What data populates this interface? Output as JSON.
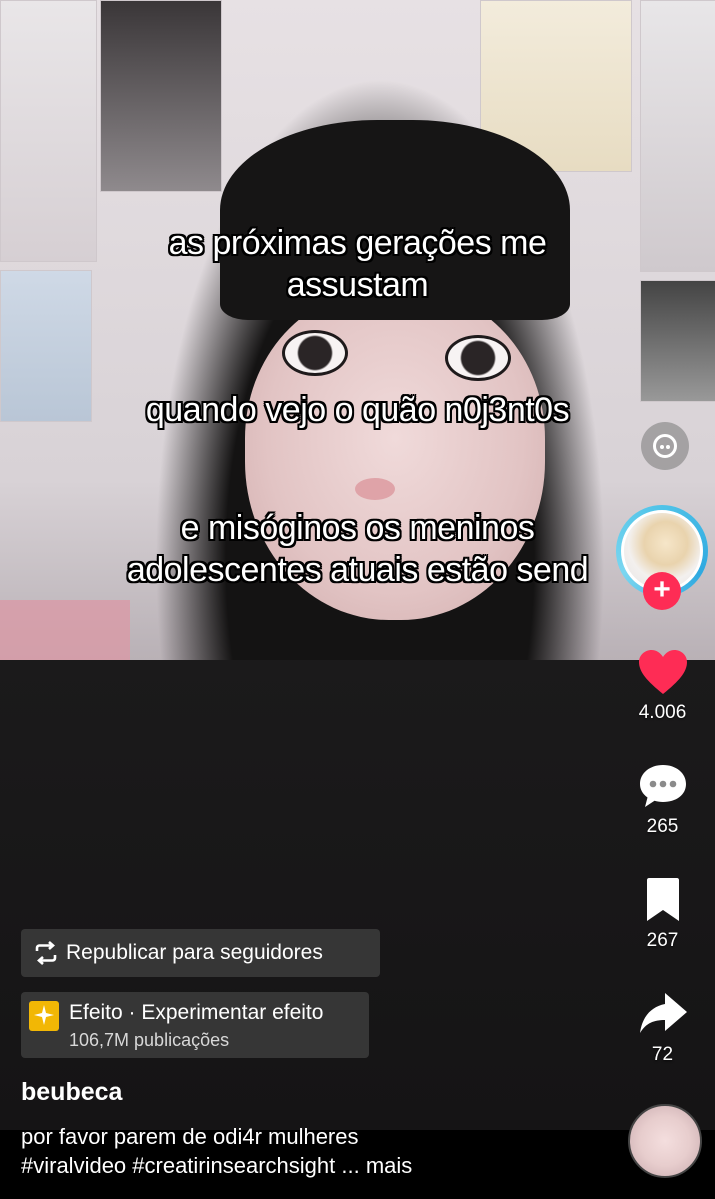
{
  "overlay": {
    "line1": "as próximas gerações me",
    "line2": "assustam",
    "line3": "quando vejo o quão n0j3nt0s",
    "line4": "e misóginos os meninos",
    "line5": "adolescentes atuais estão send"
  },
  "rail": {
    "likes": "4.006",
    "comments": "265",
    "bookmarks": "267",
    "shares": "72"
  },
  "colors": {
    "like": "#fe2c55",
    "follow": "#fe2c55",
    "avatar_ring": "#4fc3e8",
    "effect_icon": "#f2b705"
  },
  "chips": {
    "repost_label": "Republicar para seguidores",
    "effect_title": "Efeito · Experimentar efeito",
    "effect_sub": "106,7M publicações"
  },
  "post": {
    "username": "beubeca",
    "caption_line1": "por favor parem de odi4r mulheres",
    "caption_line2": "#viralvideo #creatirinsearchsight ... mais"
  },
  "icons": {
    "ai": "ai-search-icon",
    "follow": "plus-icon",
    "like": "heart-icon",
    "comment": "comment-bubble-icon",
    "bookmark": "bookmark-icon",
    "share": "share-arrow-icon",
    "repost": "repost-icon",
    "effect": "sparkle-icon",
    "music": "music-disc-icon"
  }
}
